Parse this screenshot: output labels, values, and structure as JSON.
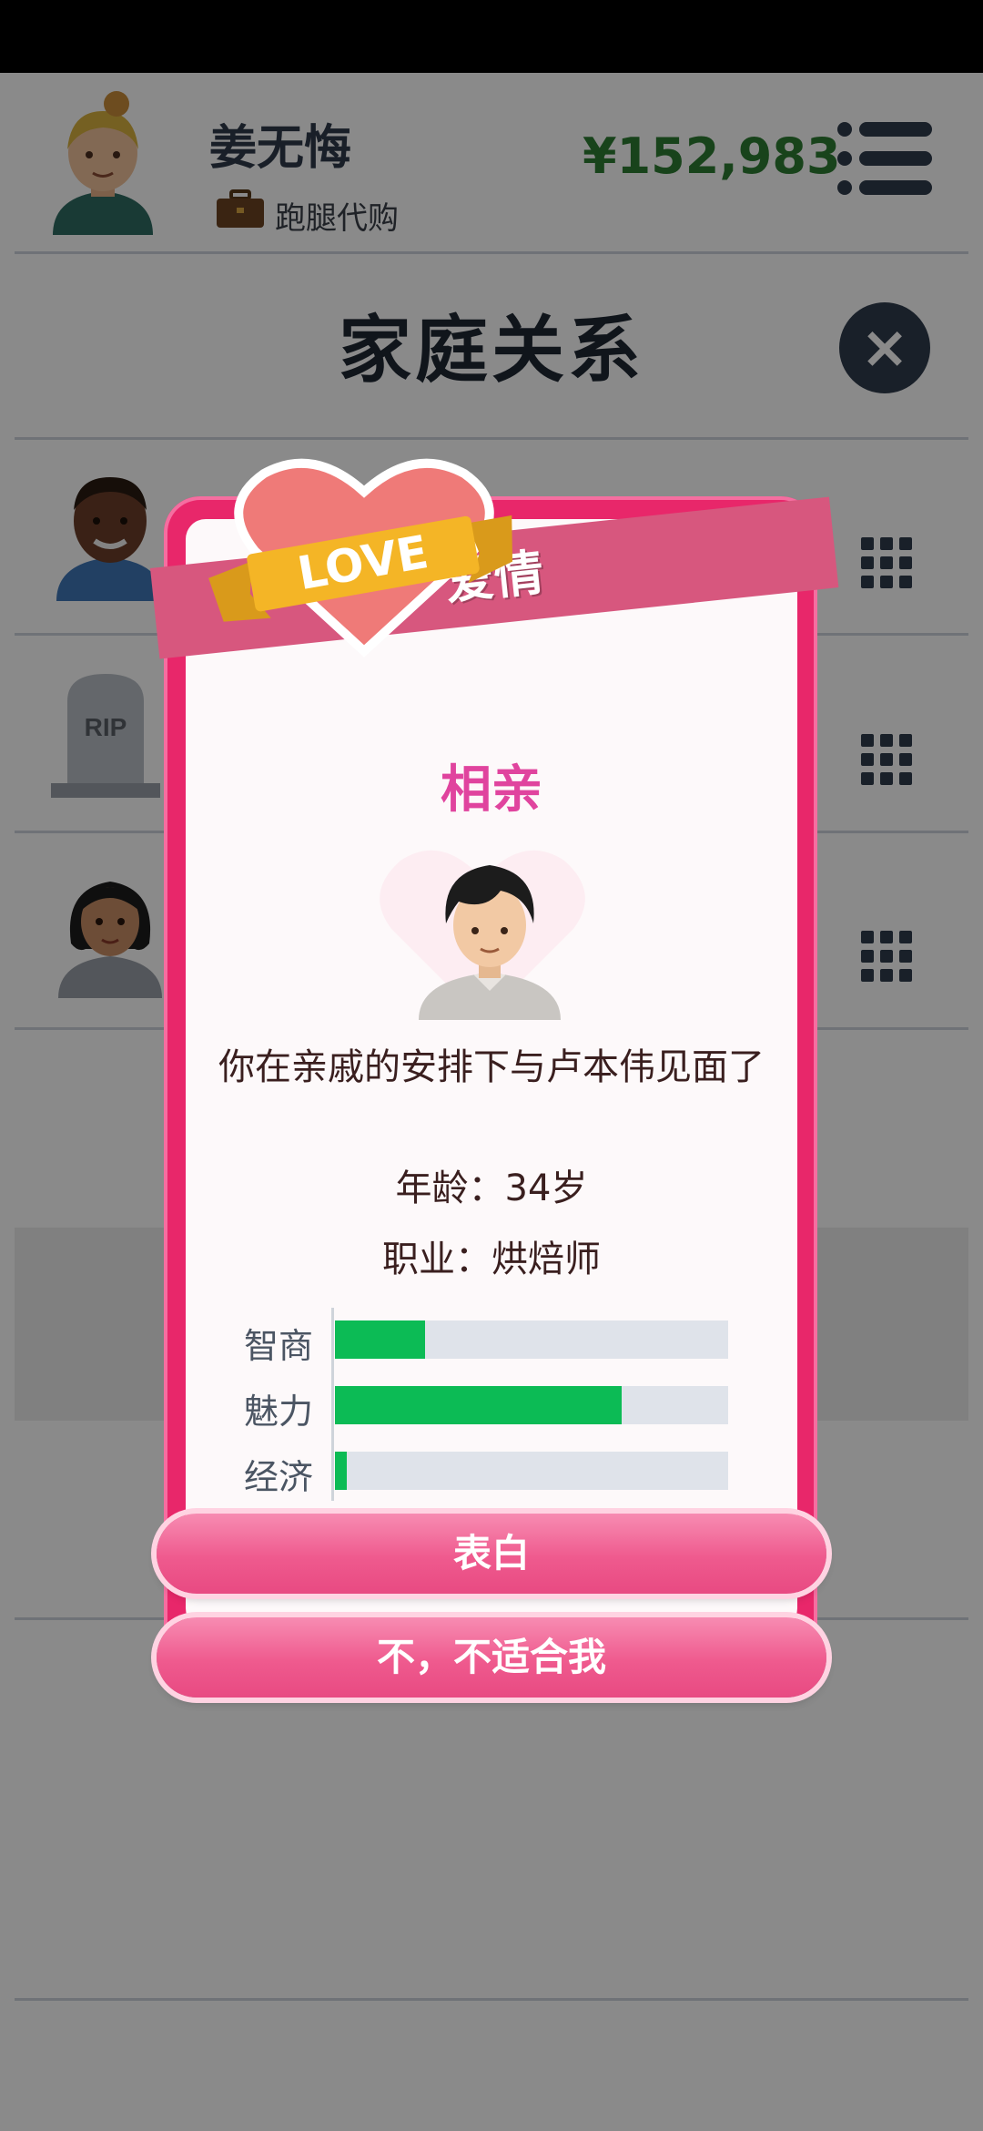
{
  "player": {
    "name": "姜无悔",
    "job": "跑腿代购",
    "money": "¥152,983"
  },
  "page": {
    "title": "家庭关系"
  },
  "dialog": {
    "ribbon_label": "爱情",
    "badge_text": "LOVE",
    "event_title": "相亲",
    "description": "你在亲戚的安排下与卢本伟见面了",
    "age_line": "年龄：34岁",
    "job_line": "职业：烘焙师",
    "stats": [
      {
        "label": "智商",
        "value": 0.23
      },
      {
        "label": "魅力",
        "value": 0.73
      },
      {
        "label": "经济",
        "value": 0.03
      }
    ],
    "confess_button": "表白",
    "decline_button": "不，不适合我"
  },
  "family_rows": [
    {
      "avatar": "father-avatar"
    },
    {
      "avatar": "tombstone-icon",
      "rip_text": "RIP"
    },
    {
      "avatar": "female-avatar"
    }
  ],
  "colors": {
    "money": "#2e7d32",
    "dialog_border": "#e8276a",
    "ribbon": "#d7577e",
    "event_title": "#e0449e",
    "bar_fill": "#0cbb55",
    "button": "#ef5a8e"
  }
}
